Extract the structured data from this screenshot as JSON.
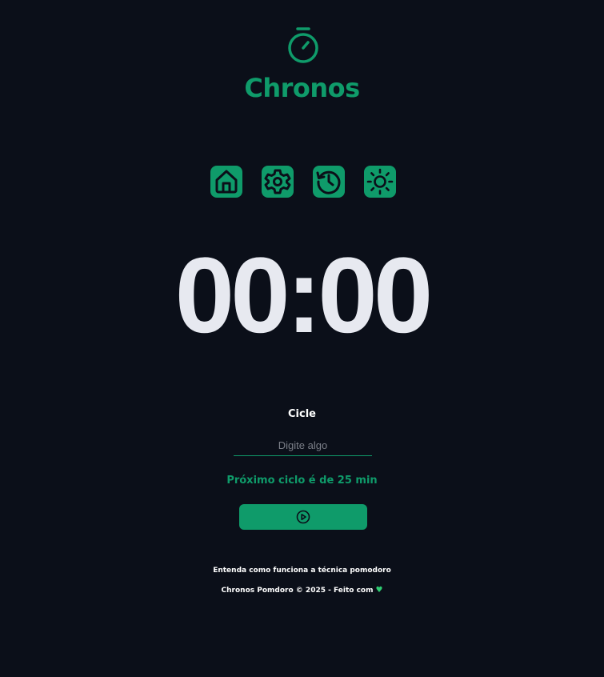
{
  "header": {
    "logo_icon": "timer-icon",
    "title": "Chronos"
  },
  "menu": {
    "items": [
      {
        "name": "home",
        "icon": "home-icon"
      },
      {
        "name": "settings",
        "icon": "gear-icon"
      },
      {
        "name": "history",
        "icon": "history-icon"
      },
      {
        "name": "theme",
        "icon": "sun-icon"
      }
    ]
  },
  "timer": {
    "display": "00:00"
  },
  "form": {
    "label": "Cicle",
    "input_value": "",
    "input_placeholder": "Digite algo",
    "next_cycle": "Próximo ciclo é de 25 min",
    "start_icon": "play-circle-icon"
  },
  "footer": {
    "link": "Entenda como funciona a técnica pomodoro",
    "copyright": "Chronos Pomdoro © 2025 - Feito com",
    "heart_icon": "heart-icon"
  },
  "colors": {
    "background": "#0b0f19",
    "accent": "#0f9b6a",
    "text": "#e7e9f0",
    "heart": "#2ecc71"
  }
}
